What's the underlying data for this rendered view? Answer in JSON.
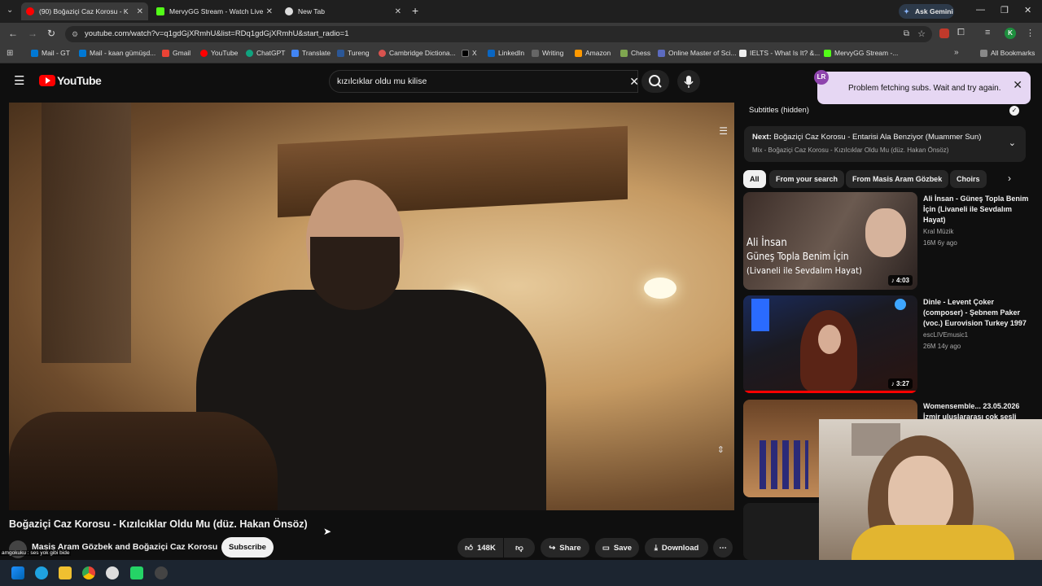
{
  "browser": {
    "tabs": [
      {
        "label": "(90) Boğaziçi Caz Korosu - K",
        "active": true
      },
      {
        "label": "MervyGG Stream - Watch Live"
      },
      {
        "label": "New Tab"
      }
    ],
    "url": "youtube.com/watch?v=q1gdGjXRmhU&list=RDq1gdGjXRmhU&start_radio=1",
    "ask_gemini": "Ask Gemini",
    "bookmarks": [
      "Mail - GT",
      "Mail - kaan gümüşd...",
      "Gmail",
      "YouTube",
      "ChatGPT",
      "Translate",
      "Tureng",
      "Cambridge Dictiona...",
      "X",
      "LinkedIn",
      "Writing",
      "Amazon",
      "Chess",
      "Online Master of Sci...",
      "IELTS - What Is It? &...",
      "MervyGG Stream -..."
    ],
    "all_bookmarks": "All Bookmarks"
  },
  "yt": {
    "logo": "YouTube",
    "search_query": "kızılcıklar oldu mu kilise",
    "video_title": "Boğaziçi Caz Korosu - Kızılcıklar Oldu Mu (düz. Hakan Önsöz)",
    "channel": "Masis Aram Gözbek and Boğaziçi Caz Korosu",
    "subscribe": "Subscribe",
    "likes": "148K",
    "share": "Share",
    "save": "Save",
    "download": "Download",
    "overlay_text": "amgokuku : ses yok gibi bide",
    "subtitles": "Subtitles (hidden)",
    "toast": "Problem fetching subs. Wait and try again.",
    "next_prefix": "Next:",
    "next_title": "Boğaziçi Caz Korosu - Entarisi Ala Benziyor (Muammer Sun)",
    "next_sub": "Mix - Boğaziçi Caz Korosu - Kızılcıklar Oldu Mu (düz. Hakan Önsöz)",
    "chips": [
      "All",
      "From your search",
      "From Masis Aram Gözbek",
      "Choirs"
    ],
    "recs": [
      {
        "title": "Ali İnsan - Güneş Topla Benim İçin (Livaneli ile Sevdalım Hayat)",
        "channel": "Kral Müzik",
        "meta": "16M  6y ago",
        "duration": "4:03",
        "thumb_text": [
          "Ali İnsan",
          "Güneş Topla Benim İçin",
          "(Livaneli ile Sevdalım Hayat)"
        ]
      },
      {
        "title": "Dinle - Levent Çoker (composer) - Şebnem Paker (voc.) Eurovision Turkey 1997",
        "channel": "escLIVEmusic1",
        "meta": "26M  14y ago",
        "duration": "3:27"
      },
      {
        "title": "Womensemble... 23.05.2026 İzmir uluslararası çok sesli",
        "channel": "",
        "meta": "",
        "duration": ""
      }
    ]
  }
}
